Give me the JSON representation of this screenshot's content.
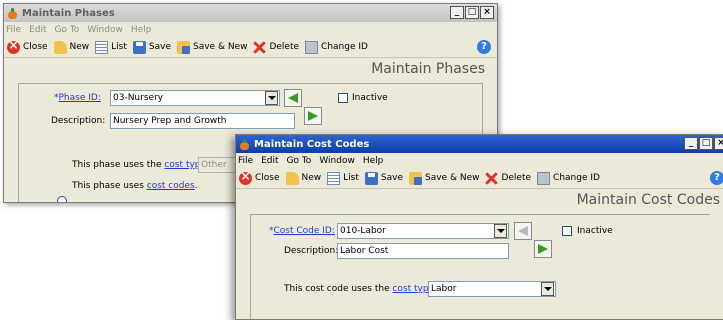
{
  "phases_window": {
    "title": "Maintain Phases",
    "menu": [
      "File",
      "Edit",
      "Go To",
      "Window",
      "Help"
    ],
    "toolbar": {
      "close": "Close",
      "new": "New",
      "list": "List",
      "save": "Save",
      "save_new": "Save & New",
      "delete": "Delete",
      "change_id": "Change ID"
    },
    "form_title": "Maintain Phases",
    "phase_id_label": "Phase ID:",
    "phase_id_value": "03-Nursery",
    "inactive_label": "Inactive",
    "description_label": "Description:",
    "description_value": "Nursery Prep and Growth",
    "radio_cost_type_prefix": "This phase uses the",
    "radio_cost_type_link": "cost type",
    "cost_type_value": "Other",
    "radio_cost_codes_prefix": "This phase uses",
    "radio_cost_codes_link": "cost codes",
    "radio_cost_codes_suffix": ".",
    "selected_option": "cost codes"
  },
  "cost_codes_window": {
    "title": "Maintain Cost Codes",
    "menu": [
      "File",
      "Edit",
      "Go To",
      "Window",
      "Help"
    ],
    "toolbar": {
      "close": "Close",
      "new": "New",
      "list": "List",
      "save": "Save",
      "save_new": "Save & New",
      "delete": "Delete",
      "change_id": "Change ID"
    },
    "form_title": "Maintain Cost Codes",
    "cost_code_id_label": "Cost Code ID:",
    "cost_code_id_value": "010-Labor",
    "inactive_label": "Inactive",
    "description_label": "Description:",
    "description_value": "Labor Cost",
    "cost_type_prefix": "This cost code uses the",
    "cost_type_link": "cost type",
    "cost_type_value": "Labor"
  },
  "window_controls": {
    "minimize": "_",
    "maximize": "□",
    "close": "×"
  },
  "help_glyph": "?",
  "required_marker": "*"
}
